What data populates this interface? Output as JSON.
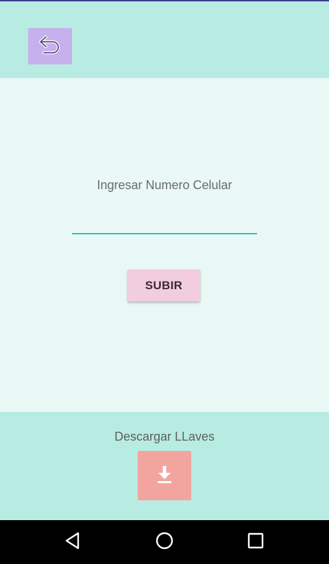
{
  "app": {
    "back_icon": "undo-arrow-icon"
  },
  "form": {
    "phone_label": "Ingresar Numero Celular",
    "phone_value": "",
    "phone_placeholder": "",
    "upload_button_label": "SUBIR"
  },
  "footer": {
    "download_label": "Descargar LLaves",
    "download_icon": "download-icon"
  },
  "navbar": {
    "back_icon": "nav-back-icon",
    "home_icon": "nav-home-icon",
    "recents_icon": "nav-recents-icon"
  },
  "colors": {
    "header_bg": "#b8ece2",
    "main_bg": "#eaf8f5",
    "back_button_bg": "#c7b0ee",
    "input_underline": "#28bfc6",
    "upload_button_bg": "#f2cde0",
    "download_button_bg": "#f2a59f",
    "navbar_bg": "#000000"
  }
}
